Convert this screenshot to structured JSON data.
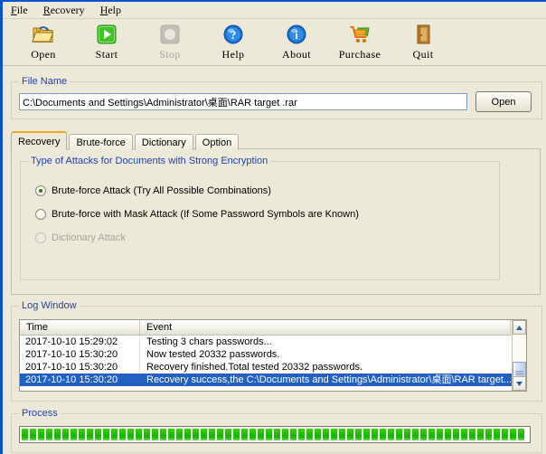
{
  "menu": {
    "items": [
      {
        "label": "File",
        "mnemonic": "F"
      },
      {
        "label": "Recovery",
        "mnemonic": "R"
      },
      {
        "label": "Help",
        "mnemonic": "H"
      }
    ]
  },
  "toolbar": {
    "buttons": [
      {
        "label": "Open",
        "icon": "open-folder-icon",
        "enabled": true
      },
      {
        "label": "Start",
        "icon": "play-icon",
        "enabled": true
      },
      {
        "label": "Stop",
        "icon": "stop-icon",
        "enabled": false
      },
      {
        "label": "Help",
        "icon": "question-mark-icon",
        "enabled": true
      },
      {
        "label": "About",
        "icon": "info-icon",
        "enabled": true
      },
      {
        "label": "Purchase",
        "icon": "shopping-cart-icon",
        "enabled": true
      },
      {
        "label": "Quit",
        "icon": "door-icon",
        "enabled": true
      }
    ]
  },
  "file_name": {
    "group_title": "File Name",
    "path_value": "C:\\Documents and Settings\\Administrator\\桌面\\RAR target .rar",
    "path_placeholder": "",
    "open_label": "Open"
  },
  "tabs": [
    {
      "label": "Recovery",
      "active": true
    },
    {
      "label": "Brute-force",
      "active": false
    },
    {
      "label": "Dictionary",
      "active": false
    },
    {
      "label": "Option",
      "active": false
    }
  ],
  "attack_panel": {
    "group_title": "Type of Attacks for Documents with Strong Encryption",
    "options": [
      {
        "label": "Brute-force Attack (Try All Possible Combinations)",
        "checked": true,
        "enabled": true
      },
      {
        "label": "Brute-force with Mask Attack (If Some Password Symbols are Known)",
        "checked": false,
        "enabled": true
      },
      {
        "label": "Dictionary Attack",
        "checked": false,
        "enabled": false
      }
    ]
  },
  "log_window": {
    "group_title": "Log Window",
    "columns": [
      "Time",
      "Event"
    ],
    "rows": [
      {
        "time": "2017-10-10 15:29:02",
        "event": "Testing  3 chars passwords...",
        "selected": false
      },
      {
        "time": "2017-10-10 15:30:20",
        "event": "Now tested  20332 passwords.",
        "selected": false
      },
      {
        "time": "2017-10-10 15:30:20",
        "event": "Recovery finished.Total tested  20332 passwords.",
        "selected": false
      },
      {
        "time": "2017-10-10 15:30:20",
        "event": "Recovery success,the C:\\Documents and Settings\\Administrator\\桌面\\RAR target...",
        "selected": true
      }
    ]
  },
  "process": {
    "group_title": "Process",
    "percent": 100,
    "segments": 62
  },
  "colors": {
    "window_border": "#0a56c8",
    "background": "#ece9d8",
    "group_title": "#2141b4",
    "selection": "#2360c4",
    "progress_green": "#23c300",
    "active_tab_accent": "#f0a81e"
  }
}
